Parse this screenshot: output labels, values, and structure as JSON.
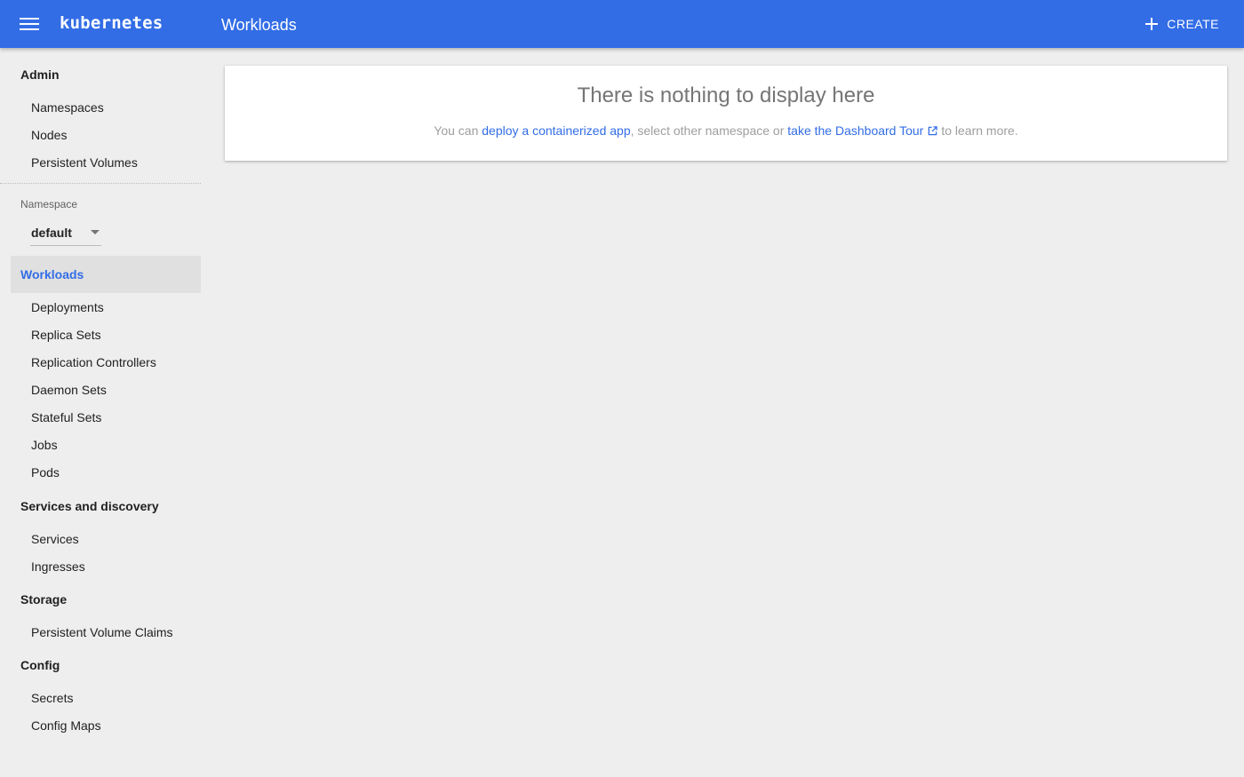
{
  "header": {
    "brand": "kubernetes",
    "title": "Workloads",
    "create_label": "CREATE",
    "color": "#326de6"
  },
  "sidebar": {
    "admin": {
      "heading": "Admin",
      "items": [
        "Namespaces",
        "Nodes",
        "Persistent Volumes"
      ]
    },
    "namespace": {
      "label": "Namespace",
      "value": "default"
    },
    "workloads": {
      "heading": "Workloads",
      "items": [
        "Deployments",
        "Replica Sets",
        "Replication Controllers",
        "Daemon Sets",
        "Stateful Sets",
        "Jobs",
        "Pods"
      ]
    },
    "services": {
      "heading": "Services and discovery",
      "items": [
        "Services",
        "Ingresses"
      ]
    },
    "storage": {
      "heading": "Storage",
      "items": [
        "Persistent Volume Claims"
      ]
    },
    "config": {
      "heading": "Config",
      "items": [
        "Secrets",
        "Config Maps"
      ]
    }
  },
  "main": {
    "empty_title": "There is nothing to display here",
    "text_prefix": "You can ",
    "link_deploy": "deploy a containerized app",
    "text_middle": ", select other namespace or ",
    "link_tour": "take the Dashboard Tour",
    "text_suffix": "to learn more."
  }
}
